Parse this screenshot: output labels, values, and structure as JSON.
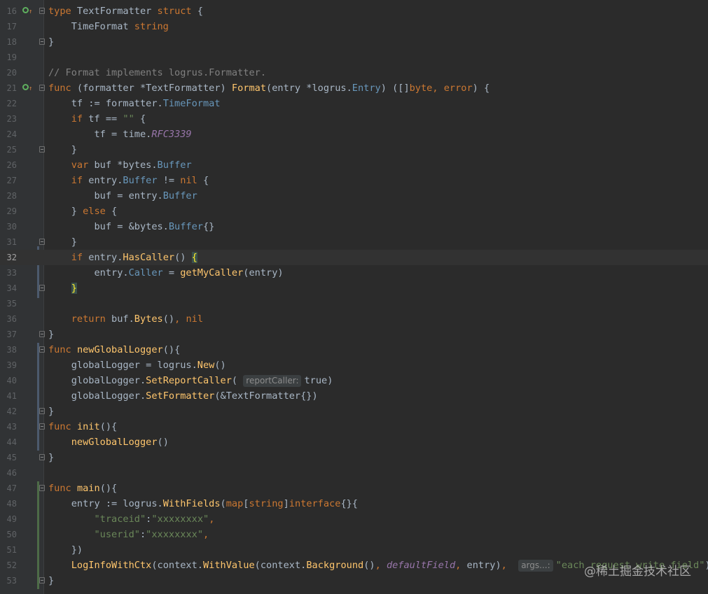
{
  "editor": {
    "current_line": 32,
    "watermark": "@稀土掘金技术社区",
    "lines": [
      {
        "n": "16",
        "code": "type TextFormatter struct {"
      },
      {
        "n": "17",
        "code": "    TimeFormat string"
      },
      {
        "n": "18",
        "code": "}"
      },
      {
        "n": "19",
        "code": ""
      },
      {
        "n": "20",
        "code": "// Format implements logrus.Formatter."
      },
      {
        "n": "21",
        "code": "func (formatter *TextFormatter) Format(entry *logrus.Entry) ([]byte, error) {"
      },
      {
        "n": "22",
        "code": "    tf := formatter.TimeFormat"
      },
      {
        "n": "23",
        "code": "    if tf == \"\" {"
      },
      {
        "n": "24",
        "code": "        tf = time.RFC3339"
      },
      {
        "n": "25",
        "code": "    }"
      },
      {
        "n": "26",
        "code": "    var buf *bytes.Buffer"
      },
      {
        "n": "27",
        "code": "    if entry.Buffer != nil {"
      },
      {
        "n": "28",
        "code": "        buf = entry.Buffer"
      },
      {
        "n": "29",
        "code": "    } else {"
      },
      {
        "n": "30",
        "code": "        buf = &bytes.Buffer{}"
      },
      {
        "n": "31",
        "code": "    }"
      },
      {
        "n": "32",
        "code": "    if entry.HasCaller() {"
      },
      {
        "n": "33",
        "code": "        entry.Caller = getMyCaller(entry)"
      },
      {
        "n": "34",
        "code": "    }"
      },
      {
        "n": "35",
        "code": ""
      },
      {
        "n": "36",
        "code": "    return buf.Bytes(), nil"
      },
      {
        "n": "37",
        "code": "}"
      },
      {
        "n": "38",
        "code": "func newGlobalLogger(){"
      },
      {
        "n": "39",
        "code": "    globalLogger = logrus.New()"
      },
      {
        "n": "40",
        "code": "    globalLogger.SetReportCaller( reportCaller: true)"
      },
      {
        "n": "41",
        "code": "    globalLogger.SetFormatter(&TextFormatter{})"
      },
      {
        "n": "42",
        "code": "}"
      },
      {
        "n": "43",
        "code": "func init(){"
      },
      {
        "n": "44",
        "code": "    newGlobalLogger()"
      },
      {
        "n": "45",
        "code": "}"
      },
      {
        "n": "46",
        "code": ""
      },
      {
        "n": "47",
        "code": "func main(){"
      },
      {
        "n": "48",
        "code": "    entry := logrus.WithFields(map[string]interface{}{"
      },
      {
        "n": "49",
        "code": "        \"traceid\":\"xxxxxxxx\","
      },
      {
        "n": "50",
        "code": "        \"userid\":\"xxxxxxxx\","
      },
      {
        "n": "51",
        "code": "    })"
      },
      {
        "n": "52",
        "code": "    LogInfoWithCtx(context.WithValue(context.Background(), defaultField, entry),  args...: \"each request write field\")"
      },
      {
        "n": "53",
        "code": "}"
      }
    ]
  },
  "colors": {
    "background": "#2b2b2b",
    "keyword": "#cc7832",
    "function": "#ffc66d",
    "type": "#6897bb",
    "comment": "#808080",
    "string": "#6a8759",
    "constant": "#9876aa"
  }
}
